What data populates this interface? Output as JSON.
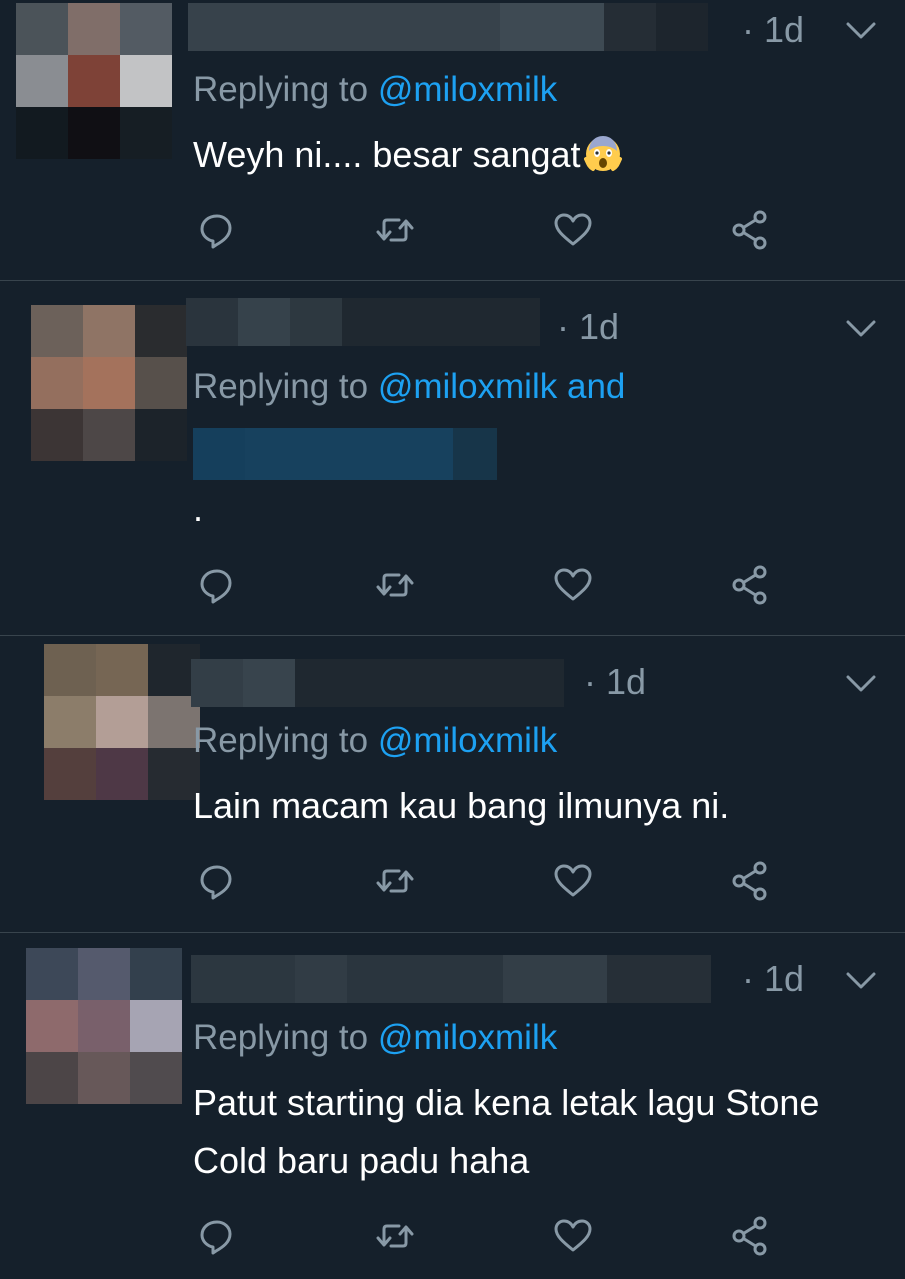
{
  "colors": {
    "background": "#15202b",
    "divider": "#38444d",
    "muted": "#8899a6",
    "link": "#1da1f2",
    "text": "#ffffff"
  },
  "icons": {
    "reply": "reply-icon",
    "retweet": "retweet-icon",
    "like": "heart-icon",
    "share": "share-icon",
    "menu": "chevron-down-icon"
  },
  "tweets": [
    {
      "time": "· 1d",
      "replying_prefix": "Replying to ",
      "handle": "@miloxmilk",
      "handle_suffix": "",
      "text": "Weyh ni.... besar sangat",
      "emoji": "face-screaming-in-fear"
    },
    {
      "time": "· 1d",
      "replying_prefix": "Replying to ",
      "handle": "@miloxmilk",
      "handle_suffix": " and",
      "text": "."
    },
    {
      "time": "· 1d",
      "replying_prefix": "Replying to ",
      "handle": "@miloxmilk",
      "handle_suffix": "",
      "text": "Lain macam kau bang ilmunya ni."
    },
    {
      "time": "· 1d",
      "replying_prefix": "Replying to ",
      "handle": "@miloxmilk",
      "handle_suffix": "",
      "text_line1": "Patut starting dia kena letak lagu Stone",
      "text_line2": "Cold baru padu haha"
    }
  ]
}
